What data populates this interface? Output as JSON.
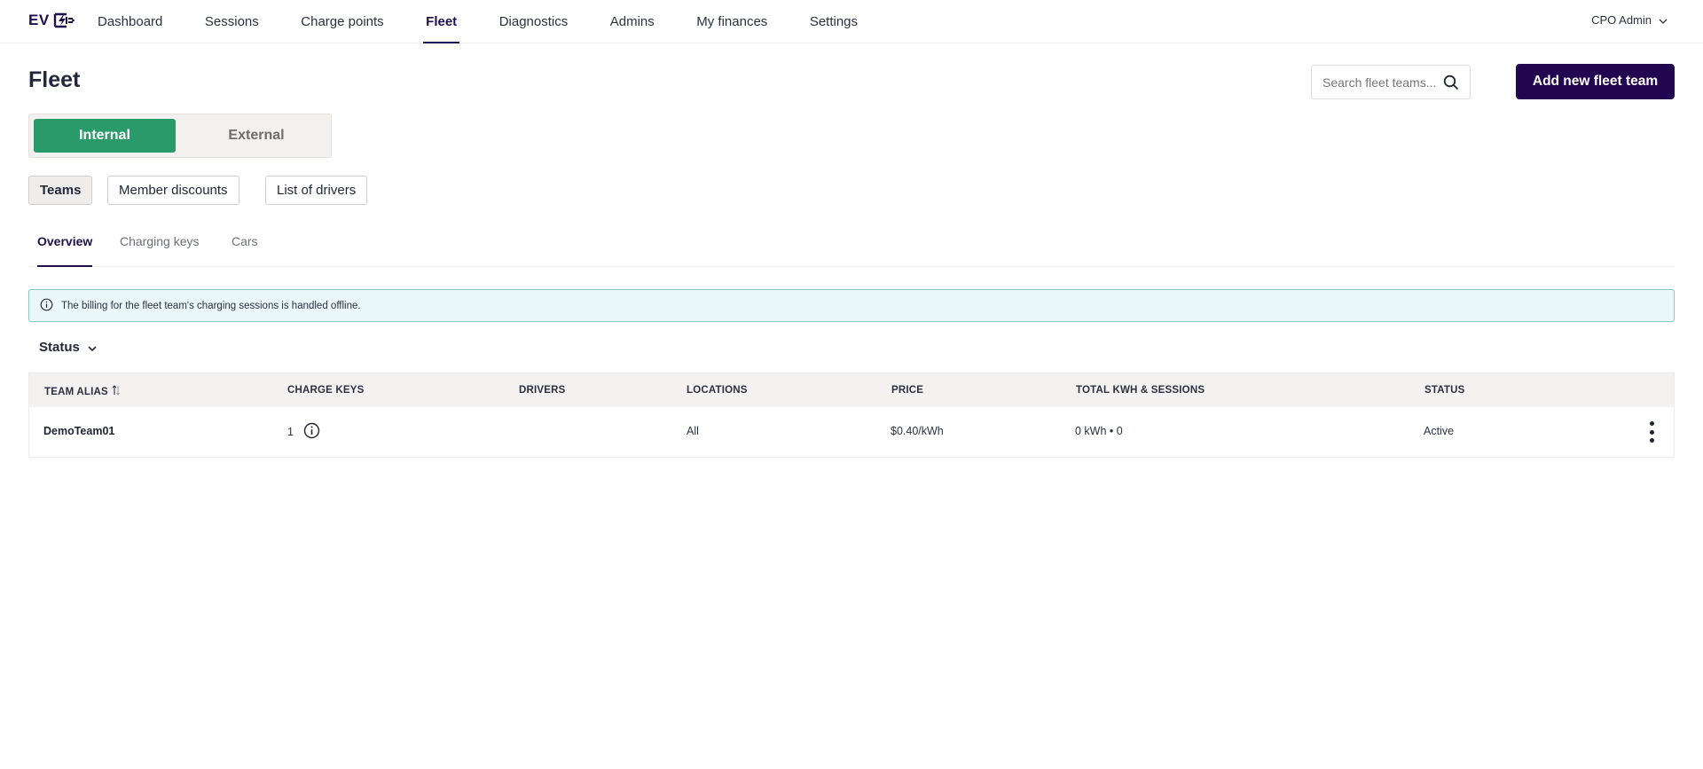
{
  "app": {
    "logo_text": "EV"
  },
  "nav": {
    "items": [
      {
        "label": "Dashboard",
        "active": false
      },
      {
        "label": "Sessions",
        "active": false
      },
      {
        "label": "Charge points",
        "active": false
      },
      {
        "label": "Fleet",
        "active": true
      },
      {
        "label": "Diagnostics",
        "active": false
      },
      {
        "label": "Admins",
        "active": false
      },
      {
        "label": "My finances",
        "active": false
      },
      {
        "label": "Settings",
        "active": false
      }
    ],
    "user": "CPO Admin"
  },
  "page": {
    "title": "Fleet",
    "search_placeholder": "Search fleet teams...",
    "add_button": "Add new fleet team"
  },
  "toggle": {
    "internal": "Internal",
    "external": "External",
    "selected": "Internal"
  },
  "pills": {
    "teams": "Teams",
    "member_discounts": "Member discounts",
    "list_of_drivers": "List of drivers"
  },
  "subtabs": {
    "overview": "Overview",
    "charging_keys": "Charging keys",
    "cars": "Cars"
  },
  "banner": {
    "text": "The billing for the fleet team's charging sessions is handled offline."
  },
  "filter": {
    "label": "Status"
  },
  "table": {
    "columns": {
      "team_alias": "TEAM ALIAS",
      "charge_keys": "CHARGE KEYS",
      "drivers": "DRIVERS",
      "locations": "LOCATIONS",
      "price": "PRICE",
      "total": "TOTAL KWH & SESSIONS",
      "status": "STATUS"
    },
    "rows": [
      {
        "team_alias": "DemoTeam01",
        "charge_keys": "1",
        "drivers": "",
        "locations": "All",
        "price": "$0.40/kWh",
        "total": "0 kWh • 0",
        "status": "Active"
      }
    ]
  },
  "colors": {
    "brand": "#22064f",
    "toggle_active": "#2b9a6a",
    "banner_bg": "#eaf8fb",
    "banner_border": "#8fc6c0"
  },
  "icons": {
    "logo": "lightning-plug-icon",
    "user_menu": "chevron-down-icon",
    "search": "search-icon",
    "banner": "info-icon",
    "filter": "chevron-down-icon",
    "sort": "sort-icon",
    "charge_keys_info": "info-icon",
    "row_menu": "kebab-menu-icon"
  }
}
